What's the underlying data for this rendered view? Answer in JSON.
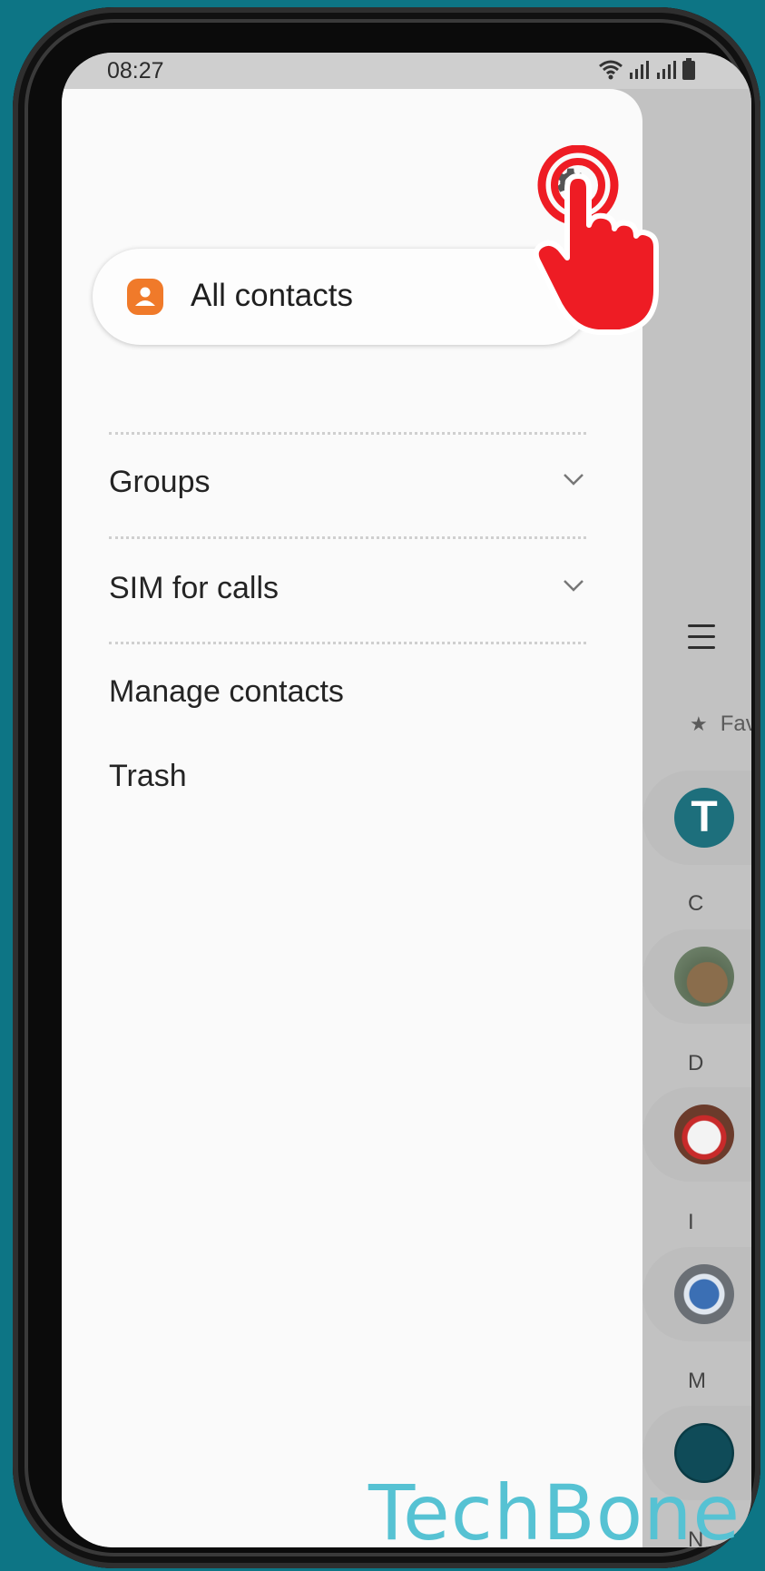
{
  "status_bar": {
    "time": "08:27"
  },
  "drawer": {
    "header_item": {
      "label": "All contacts"
    },
    "items": [
      {
        "label": "Groups",
        "expandable": true
      },
      {
        "label": "SIM for calls",
        "expandable": true
      },
      {
        "label": "Manage contacts",
        "expandable": false
      },
      {
        "label": "Trash",
        "expandable": false
      }
    ]
  },
  "contact_list": {
    "favorites_label": "Fav",
    "sections": [
      "C",
      "D",
      "I",
      "M",
      "N"
    ],
    "favorite_avatar_initial": "T"
  },
  "watermark": "TechBone",
  "colors": {
    "background": "#0d7585",
    "drawer_bg": "#fafafa",
    "accent_orange": "#f07a2a",
    "tap_red": "#ee1c24",
    "avatar_teal": "#1d6f7c",
    "watermark": "#56c2d3"
  },
  "icons": [
    "gear-icon",
    "contact-person-icon",
    "chevron-down-icon",
    "menu-icon",
    "star-icon",
    "wifi-icon",
    "signal-icon",
    "battery-icon",
    "tap-hand-icon"
  ]
}
